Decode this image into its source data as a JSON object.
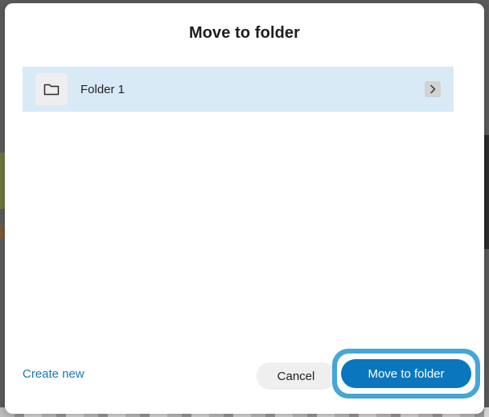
{
  "dialog": {
    "title": "Move to folder"
  },
  "folders": [
    {
      "name": "Folder 1",
      "icon": "folder-icon"
    }
  ],
  "footer": {
    "create_new_label": "Create new",
    "cancel_label": "Cancel",
    "move_label": "Move to folder"
  },
  "colors": {
    "accent": "#0a76bd",
    "link": "#1777b8",
    "selected_row": "#d8eaf5",
    "focus_ring": "#44a6d9"
  }
}
